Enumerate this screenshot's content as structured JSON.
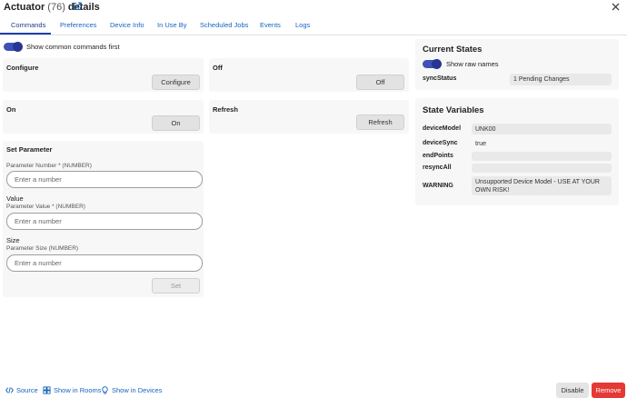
{
  "header": {
    "title": "Actuator",
    "count": "(76)",
    "title_suffix": "details"
  },
  "tabs": [
    {
      "label": "Commands",
      "active": true
    },
    {
      "label": "Preferences"
    },
    {
      "label": "Device Info"
    },
    {
      "label": "In Use By"
    },
    {
      "label": "Scheduled Jobs"
    },
    {
      "label": "Events"
    },
    {
      "label": "Logs"
    }
  ],
  "commands": {
    "show_common_label": "Show common commands first",
    "configure": {
      "title": "Configure",
      "button": "Configure"
    },
    "off": {
      "title": "Off",
      "button": "Off"
    },
    "on": {
      "title": "On",
      "button": "On"
    },
    "refresh": {
      "title": "Refresh",
      "button": "Refresh"
    },
    "set_parameter": {
      "title": "Set Parameter",
      "param_number_label": "Parameter Number * (NUMBER)",
      "param_number_placeholder": "Enter a number",
      "value_heading": "Value",
      "param_value_label": "Parameter Value * (NUMBER)",
      "param_value_placeholder": "Enter a number",
      "size_heading": "Size",
      "param_size_label": "Parameter Size (NUMBER)",
      "param_size_placeholder": "Enter a number",
      "button": "Set"
    }
  },
  "current_states": {
    "title": "Current States",
    "show_raw_label": "Show raw names",
    "rows": [
      {
        "name": "syncStatus",
        "value": "1 Pending Changes"
      }
    ]
  },
  "state_variables": {
    "title": "State Variables",
    "rows": [
      {
        "name": "deviceModel",
        "value": "UNK00"
      },
      {
        "name": "deviceSync",
        "value": "true"
      },
      {
        "name": "endPoints",
        "value": ""
      },
      {
        "name": "resyncAll",
        "value": ""
      },
      {
        "name": "WARNING",
        "value": "Unsupported Device Model - USE AT YOUR OWN RISK!"
      }
    ]
  },
  "footer": {
    "source": "Source",
    "show_in_rooms": "Show in Rooms",
    "show_in_devices": "Show in Devices",
    "disable": "Disable",
    "remove": "Remove"
  },
  "colors": {
    "accent": "#3f51b5",
    "link": "#1565c0",
    "danger": "#e53935"
  }
}
